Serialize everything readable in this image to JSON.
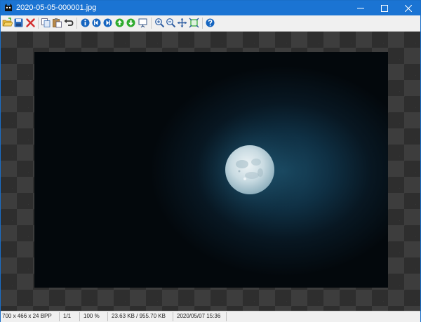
{
  "window": {
    "title": "2020-05-05-000001.jpg"
  },
  "titlebar_buttons": [
    "minimize-icon",
    "maximize-icon",
    "close-icon"
  ],
  "toolbar": {
    "buttons": [
      "open-folder-icon",
      "save-icon",
      "delete-icon",
      "copy-icon",
      "paste-icon",
      "undo-icon",
      "info-icon",
      "previous-icon",
      "next-icon",
      "move-up-icon",
      "move-down-icon",
      "slideshow-icon",
      "zoom-in-icon",
      "zoom-out-icon",
      "fit-window-icon",
      "actual-size-icon",
      "help-icon"
    ]
  },
  "status": {
    "dimensions": "700 x 466 x 24 BPP",
    "page": "1/1",
    "zoom": "100 %",
    "size": "23.63 KB / 955.70 KB",
    "date": "2020/05/07 15:36"
  },
  "colors": {
    "titlebar": "#1b74d3",
    "accent_blue": "#1565c0",
    "delete_red": "#d32f2f",
    "nav_green": "#2eab2e"
  }
}
